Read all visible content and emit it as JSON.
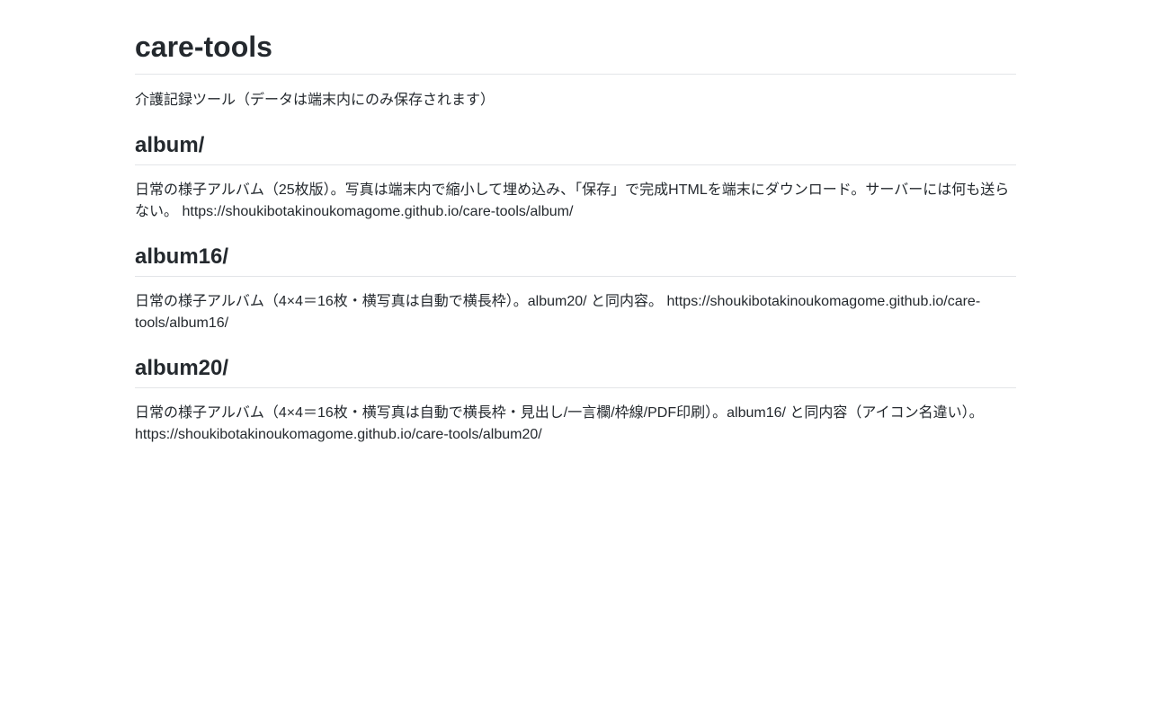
{
  "page": {
    "title": "care-tools",
    "intro": "介護記録ツール（データは端末内にのみ保存されます）"
  },
  "sections": [
    {
      "heading": "album/",
      "description": "日常の様子アルバム（25枚版）。写真は端末内で縮小して埋め込み、「保存」で完成HTMLを端末にダウンロード。サーバーには何も送らない。",
      "url": "https://shoukibotakinoukomagome.github.io/care-tools/album/"
    },
    {
      "heading": "album16/",
      "description": "日常の様子アルバム（4×4＝16枚・横写真は自動で横長枠）。album20/ と同内容。",
      "url": "https://shoukibotakinoukomagome.github.io/care-tools/album16/"
    },
    {
      "heading": "album20/",
      "description": "日常の様子アルバム（4×4＝16枚・横写真は自動で横長枠・見出し/一言欄/枠線/PDF印刷）。album16/ と同内容（アイコン名違い）。",
      "url": "https://shoukibotakinoukomagome.github.io/care-tools/album20/"
    }
  ]
}
